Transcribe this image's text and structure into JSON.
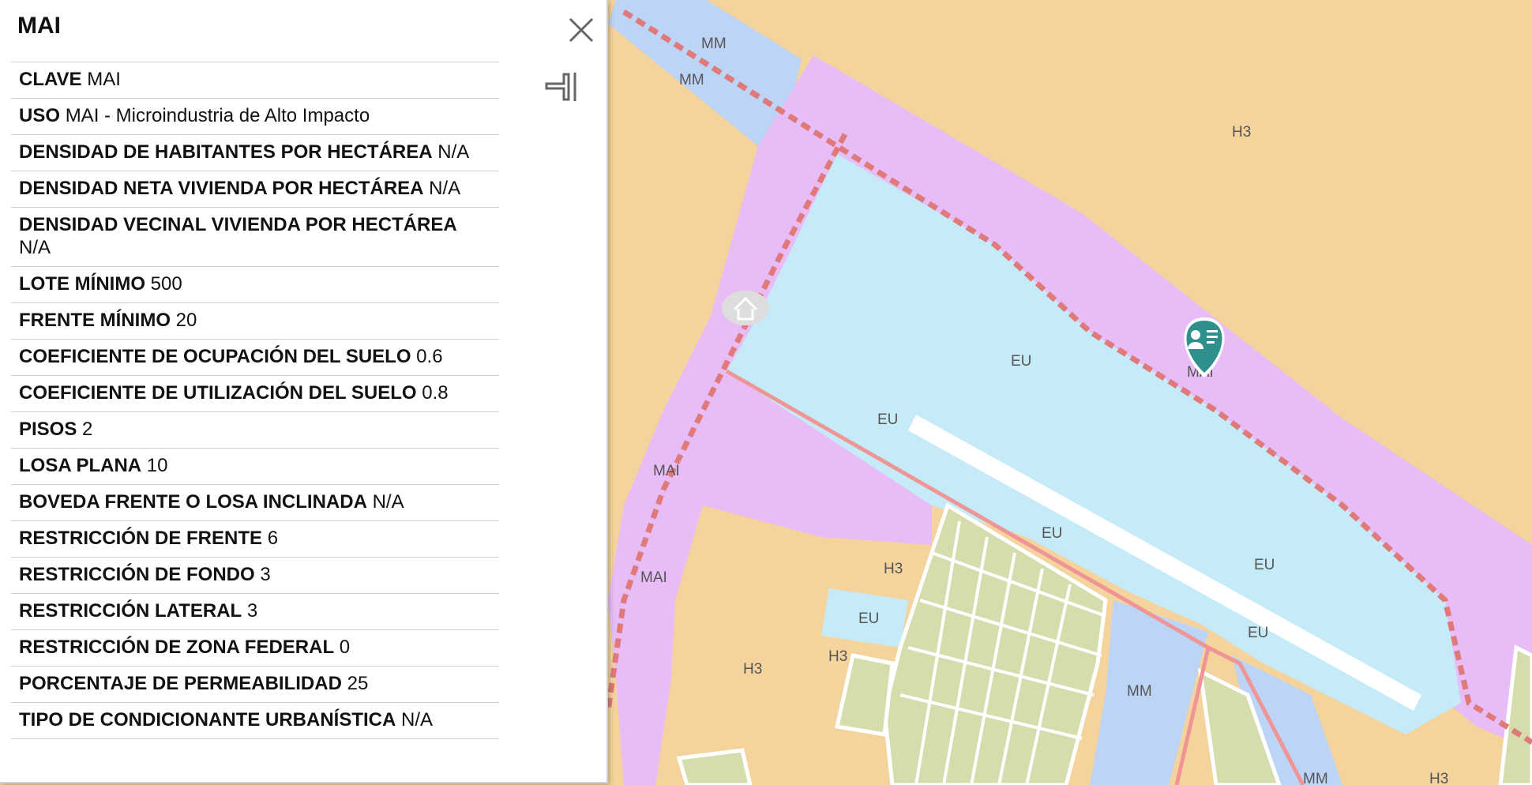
{
  "map": {
    "zone_labels": [
      {
        "text": "MM"
      },
      {
        "text": "MM"
      },
      {
        "text": "H3"
      },
      {
        "text": "EU"
      },
      {
        "text": "MAI"
      },
      {
        "text": "EU"
      },
      {
        "text": "MAI"
      },
      {
        "text": "MAI"
      },
      {
        "text": "EU"
      },
      {
        "text": "H3"
      },
      {
        "text": "EU"
      },
      {
        "text": "EU"
      },
      {
        "text": "EU"
      },
      {
        "text": "H3"
      },
      {
        "text": "H3"
      },
      {
        "text": "MM"
      },
      {
        "text": "MM"
      },
      {
        "text": "H3"
      }
    ],
    "colors": {
      "background": "#f5d39c",
      "mai_zone": "#e8bcf7",
      "eu_zone": "#c6ebf8",
      "mm_zone": "#bcd4f5",
      "h3_blocks": "#d4ddab",
      "boundary": "#e07a7a",
      "marker": "#2f8f8a"
    },
    "icons": [
      "info-marker-icon",
      "home-marker-icon"
    ]
  },
  "panel": {
    "title": "MAI",
    "close_icon": "close-icon",
    "layer_icon": "layer-toggle-icon",
    "attributes": [
      {
        "key": "CLAVE",
        "value": "MAI"
      },
      {
        "key": "USO",
        "value": "MAI - Microindustria de Alto Impacto"
      },
      {
        "key": "DENSIDAD DE HABITANTES POR HECTÁREA",
        "value": "N/A"
      },
      {
        "key": "DENSIDAD NETA VIVIENDA POR HECTÁREA",
        "value": "N/A"
      },
      {
        "key": "DENSIDAD VECINAL VIVIENDA POR HECTÁREA",
        "value": "N/A"
      },
      {
        "key": "LOTE MÍNIMO",
        "value": "500"
      },
      {
        "key": "FRENTE MÍNIMO",
        "value": "20"
      },
      {
        "key": "COEFICIENTE DE OCUPACIÓN DEL SUELO",
        "value": "0.6"
      },
      {
        "key": "COEFICIENTE DE UTILIZACIÓN DEL SUELO",
        "value": "0.8"
      },
      {
        "key": "PISOS",
        "value": "2"
      },
      {
        "key": "LOSA PLANA",
        "value": "10"
      },
      {
        "key": "BOVEDA FRENTE O LOSA INCLINADA",
        "value": "N/A"
      },
      {
        "key": "RESTRICCIÓN DE FRENTE",
        "value": "6"
      },
      {
        "key": "RESTRICCIÓN DE FONDO",
        "value": "3"
      },
      {
        "key": "RESTRICCIÓN LATERAL",
        "value": "3"
      },
      {
        "key": "RESTRICCIÓN DE ZONA FEDERAL",
        "value": "0"
      },
      {
        "key": "PORCENTAJE DE PERMEABILIDAD",
        "value": "25"
      },
      {
        "key": "TIPO DE CONDICIONANTE URBANÍSTICA",
        "value": "N/A"
      }
    ]
  }
}
